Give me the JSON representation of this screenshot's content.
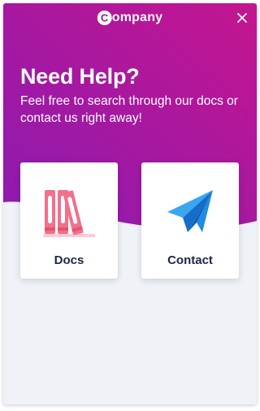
{
  "header": {
    "logo_text": "ompany",
    "logo_letter": "C",
    "close_icon": "close-icon"
  },
  "hero": {
    "title": "Need Help?",
    "subtitle": "Feel free to search through our docs or contact us right away!"
  },
  "cards": [
    {
      "label": "Docs",
      "icon": "books-icon"
    },
    {
      "label": "Contact",
      "icon": "paper-plane-icon"
    }
  ],
  "colors": {
    "gradient_start": "#8b1bb0",
    "gradient_end": "#c4158f",
    "panel_background": "#eff3f7",
    "card_label": "#1b2745",
    "books_pink": "#f2708a",
    "plane_blue": "#1a86e6"
  }
}
